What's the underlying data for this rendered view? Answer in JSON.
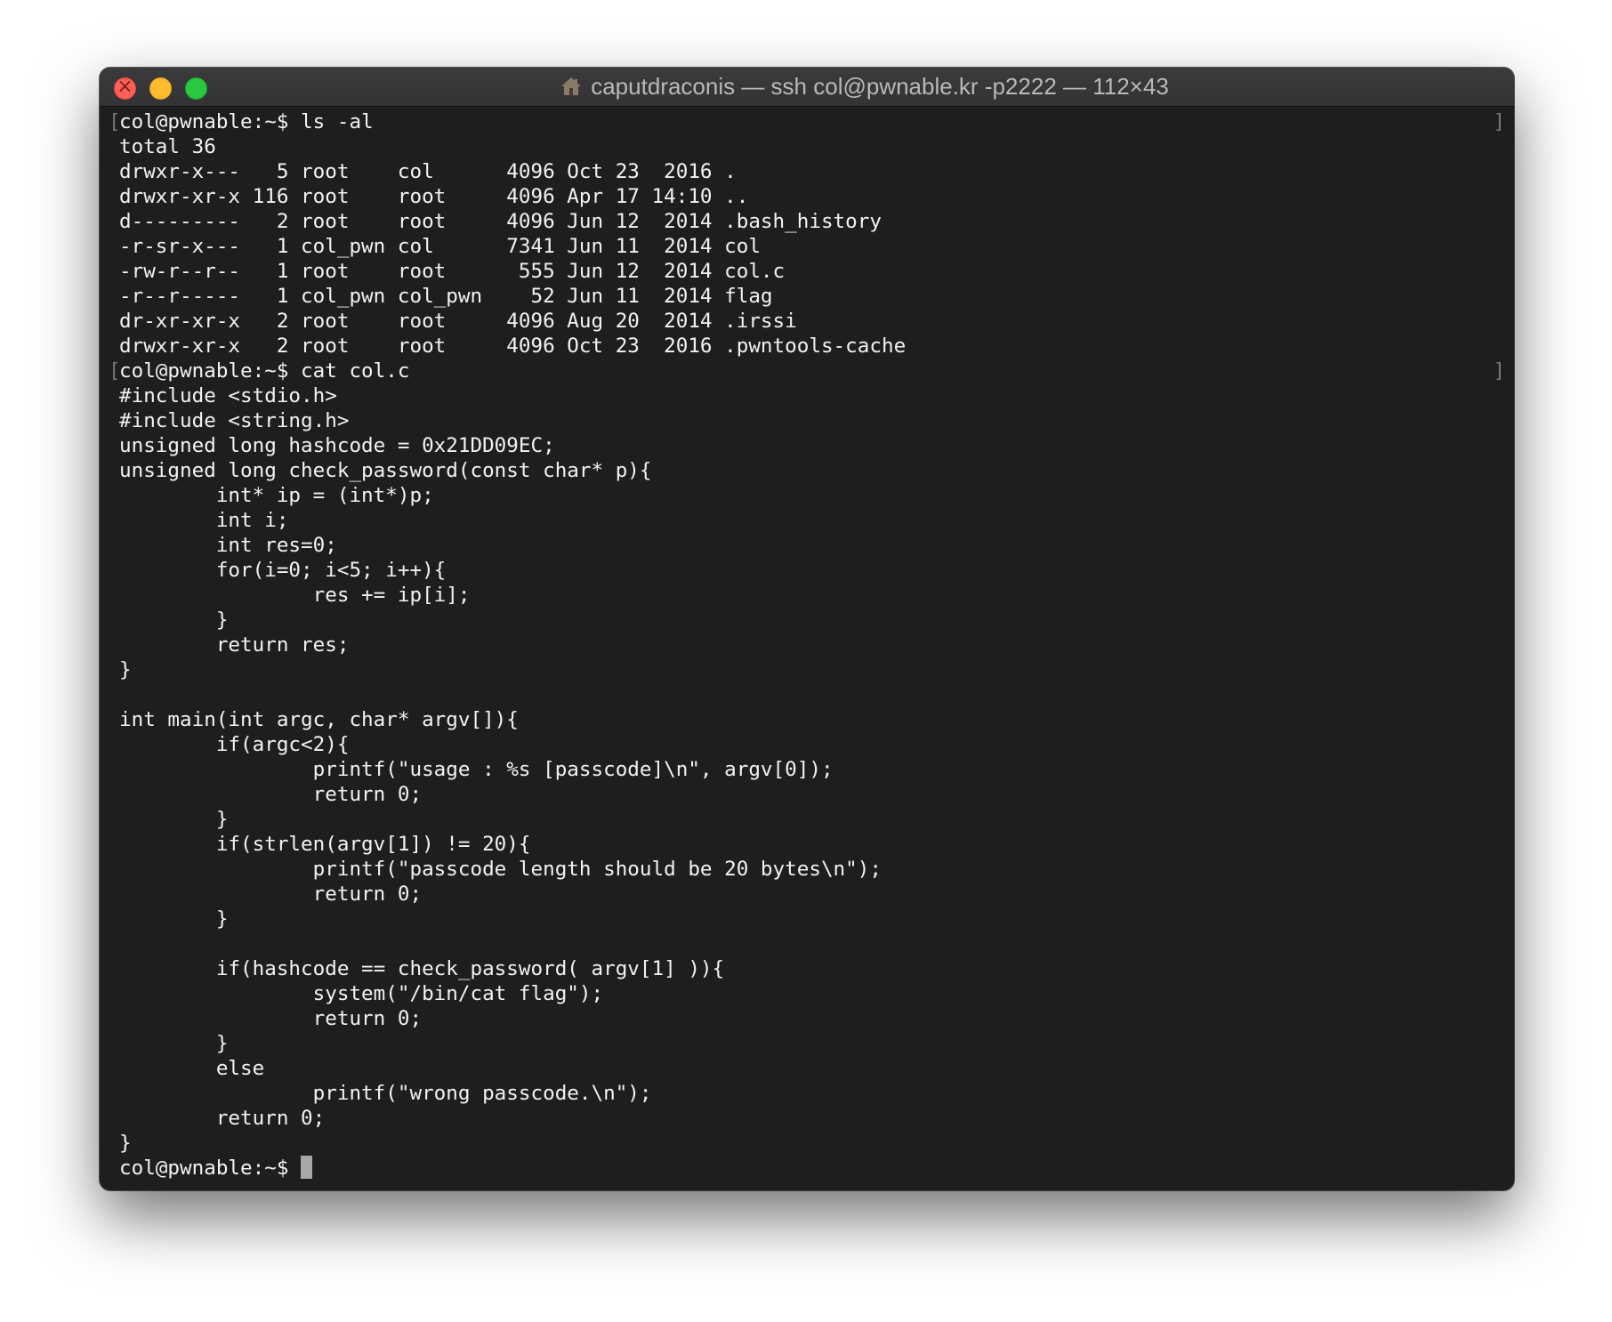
{
  "window": {
    "title": "caputdraconis — ssh col@pwnable.kr -p2222 — 112×43"
  },
  "terminal": {
    "lines": [
      {
        "text": "col@pwnable:~$ ls -al",
        "prompt": true
      },
      {
        "text": "total 36"
      },
      {
        "text": "drwxr-x---   5 root    col      4096 Oct 23  2016 ."
      },
      {
        "text": "drwxr-xr-x 116 root    root     4096 Apr 17 14:10 .."
      },
      {
        "text": "d---------   2 root    root     4096 Jun 12  2014 .bash_history"
      },
      {
        "text": "-r-sr-x---   1 col_pwn col      7341 Jun 11  2014 col"
      },
      {
        "text": "-rw-r--r--   1 root    root      555 Jun 12  2014 col.c"
      },
      {
        "text": "-r--r-----   1 col_pwn col_pwn    52 Jun 11  2014 flag"
      },
      {
        "text": "dr-xr-xr-x   2 root    root     4096 Aug 20  2014 .irssi"
      },
      {
        "text": "drwxr-xr-x   2 root    root     4096 Oct 23  2016 .pwntools-cache"
      },
      {
        "text": "col@pwnable:~$ cat col.c",
        "prompt": true
      },
      {
        "text": "#include <stdio.h>"
      },
      {
        "text": "#include <string.h>"
      },
      {
        "text": "unsigned long hashcode = 0x21DD09EC;"
      },
      {
        "text": "unsigned long check_password(const char* p){"
      },
      {
        "text": "        int* ip = (int*)p;"
      },
      {
        "text": "        int i;"
      },
      {
        "text": "        int res=0;"
      },
      {
        "text": "        for(i=0; i<5; i++){"
      },
      {
        "text": "                res += ip[i];"
      },
      {
        "text": "        }"
      },
      {
        "text": "        return res;"
      },
      {
        "text": "}"
      },
      {
        "text": ""
      },
      {
        "text": "int main(int argc, char* argv[]){"
      },
      {
        "text": "        if(argc<2){"
      },
      {
        "text": "                printf(\"usage : %s [passcode]\\n\", argv[0]);"
      },
      {
        "text": "                return 0;"
      },
      {
        "text": "        }"
      },
      {
        "text": "        if(strlen(argv[1]) != 20){"
      },
      {
        "text": "                printf(\"passcode length should be 20 bytes\\n\");"
      },
      {
        "text": "                return 0;"
      },
      {
        "text": "        }"
      },
      {
        "text": ""
      },
      {
        "text": "        if(hashcode == check_password( argv[1] )){"
      },
      {
        "text": "                system(\"/bin/cat flag\");"
      },
      {
        "text": "                return 0;"
      },
      {
        "text": "        }"
      },
      {
        "text": "        else"
      },
      {
        "text": "                printf(\"wrong passcode.\\n\");"
      },
      {
        "text": "        return 0;"
      },
      {
        "text": "}"
      }
    ],
    "current_prompt": "col@pwnable:~$ "
  }
}
